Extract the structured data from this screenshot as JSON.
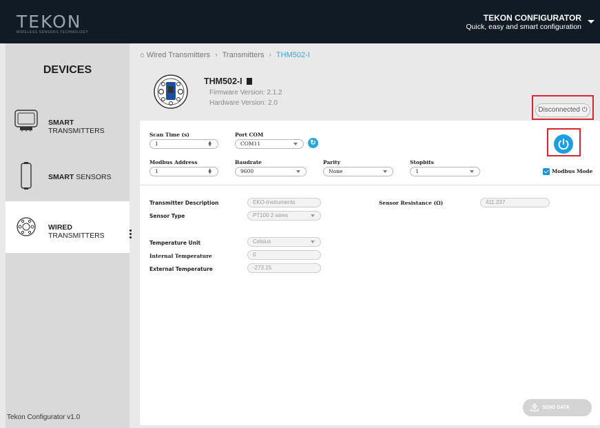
{
  "header": {
    "logo_text": "TEKON",
    "logo_subtitle": "WIRELESS SENSORS TECHNOLOGY",
    "app_title": "TEKON CONFIGURATOR",
    "app_subtitle": "Quick, easy and smart configuration"
  },
  "sidebar": {
    "title": "DEVICES",
    "items": [
      {
        "bold": "SMART",
        "label": " TRANSMITTERS"
      },
      {
        "bold": "SMART",
        "label": " SENSORS"
      },
      {
        "bold": "WIRED",
        "label": " TRANSMITTERS"
      }
    ],
    "footer": "Tekon Configurator v1.0"
  },
  "breadcrumb": [
    "Wired Transmitters",
    "Transmitters",
    "THM502-I"
  ],
  "device": {
    "name": "THM502-I",
    "firmware": "Firmware Version: 2.1.2",
    "hardware": "Hardware Version: 2.0",
    "status": "Disconnected"
  },
  "settings": {
    "scan_time": {
      "label": "Scan Time (s)",
      "value": "1"
    },
    "port_com": {
      "label": "Port COM",
      "value": "COM11"
    },
    "modbus_address": {
      "label": "Modbus Address",
      "value": "1"
    },
    "baudrate": {
      "label": "Baudrate",
      "value": "9600"
    },
    "parity": {
      "label": "Parity",
      "value": "None"
    },
    "stopbits": {
      "label": "Stopbits",
      "value": "1"
    },
    "modbus_mode": {
      "label": "Modbus Mode",
      "checked": true
    }
  },
  "params": {
    "transmitter_description": {
      "label": "Transmitter Description",
      "value": "EKO-Instruments"
    },
    "sensor_type": {
      "label": "Sensor Type",
      "value": "PT100 2 wires"
    },
    "sensor_resistance": {
      "label": "Sensor Resistance (Ω)",
      "value": "411.237"
    },
    "temperature_unit": {
      "label": "Temperature Unit",
      "value": "Celsius"
    },
    "internal_temperature": {
      "label": "Internal Temperature",
      "value": "0"
    },
    "external_temperature": {
      "label": "External Temperature",
      "value": "-273.15"
    }
  },
  "send_button": "SEND DATA",
  "colors": {
    "header_bg": "#111b25",
    "accent": "#1c9ee3",
    "highlight_box": "#d7262e"
  }
}
